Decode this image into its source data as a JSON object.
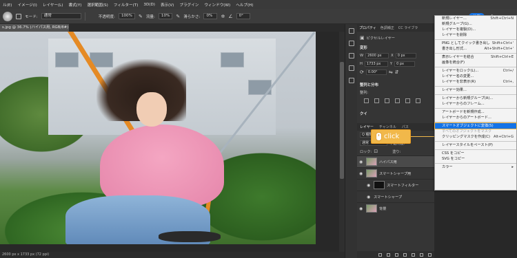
{
  "menubar": {
    "items": [
      "ル(E)",
      "イメージ(I)",
      "レイヤー(L)",
      "書式(Y)",
      "選択範囲(S)",
      "フィルター(T)",
      "3D(D)",
      "表示(V)",
      "プラグイン",
      "ウィンドウ(W)",
      "ヘルプ(H)"
    ]
  },
  "options": {
    "brush_size": "150",
    "mode_label": "モード:",
    "mode_value": "通常",
    "opacity_label": "不透明度:",
    "opacity_value": "100%",
    "flow_label": "流量:",
    "flow_value": "10%",
    "smoothing_label": "滑らかさ:",
    "smoothing_value": "0%",
    "angle_value": "0°",
    "share_label": "共有"
  },
  "document": {
    "tab_title": "s.jpg @ 36.7% (ハイパス用, RGB/8#) *",
    "status": "2600 px x 1733 px (72 ppi)"
  },
  "panel": {
    "tabs": [
      "プロパティ",
      "色調補正",
      "CC ライブラ"
    ],
    "layer_kind": "ピクセルレイヤー",
    "transform_heading": "変形",
    "w_label": "W",
    "w_value": "2600 px",
    "h_label": "H",
    "h_value": "1733 px",
    "x_label": "X",
    "x_value": "0 px",
    "y_label": "Y",
    "y_value": "0 px",
    "rotation_value": "0.00°",
    "align_heading": "整列と分布",
    "align_label": "整列:",
    "quick_heading": "クイ",
    "layer_tabs": [
      "レイヤー",
      "チャンネル",
      "パス"
    ],
    "kind_filter": "Q 種類",
    "blend_mode": "通常",
    "opacity_label": "不透明度:",
    "lock_label": "ロック:",
    "fill_label": "塗り:",
    "layers": [
      "ハイパス用",
      "スマートシャープ用",
      "スマートフィルター",
      "スマートシャープ",
      "背景"
    ]
  },
  "callout": {
    "label": "click"
  },
  "context_menu": {
    "items": [
      {
        "label": "新規レイヤー...",
        "shortcut": "Shift+Ctrl+N"
      },
      {
        "label": "新規グループ(G)...",
        "shortcut": ""
      },
      {
        "label": "レイヤーを複製(D)...",
        "shortcut": ""
      },
      {
        "label": "レイヤーを削除",
        "shortcut": ""
      },
      {
        "sep": true
      },
      {
        "label": "PNG としてクイック書き出し",
        "shortcut": "Shift+Ctrl+'"
      },
      {
        "label": "書き出し形式...",
        "shortcut": "Alt+Shift+Ctrl+'"
      },
      {
        "sep": true
      },
      {
        "label": "表示レイヤーを結合",
        "shortcut": "Shift+Ctrl+E"
      },
      {
        "label": "画像を統合(F)",
        "shortcut": ""
      },
      {
        "sep": true
      },
      {
        "label": "レイヤーをロック(L)...",
        "shortcut": "Ctrl+/"
      },
      {
        "label": "レイヤー名の変更...",
        "shortcut": ""
      },
      {
        "label": "レイヤーを非表示(R)",
        "shortcut": "Ctrl+,"
      },
      {
        "sep": true
      },
      {
        "label": "レイヤー効果...",
        "shortcut": ""
      },
      {
        "sep": true
      },
      {
        "label": "レイヤーから新規グループ(A)...",
        "shortcut": ""
      },
      {
        "label": "レイヤーからのフレーム...",
        "shortcut": ""
      },
      {
        "sep": true
      },
      {
        "label": "アートボードを新規作成...",
        "shortcut": ""
      },
      {
        "label": "レイヤーからのアートボード...",
        "shortcut": ""
      },
      {
        "sep": true
      },
      {
        "label": "スマートオブジェクトに変換(S)",
        "shortcut": "",
        "highlight": true
      },
      {
        "label": "すべてのオブジェクトをマスク",
        "shortcut": "",
        "dim": true
      },
      {
        "label": "クリッピングマスクを作成(C)",
        "shortcut": "Alt+Ctrl+G"
      },
      {
        "sep": true
      },
      {
        "label": "レイヤースタイルをペースト(P)",
        "shortcut": ""
      },
      {
        "sep": true
      },
      {
        "label": "CSS をコピー",
        "shortcut": ""
      },
      {
        "label": "SVG をコピー",
        "shortcut": ""
      },
      {
        "sep": true
      },
      {
        "label": "カラー",
        "shortcut": "▸"
      }
    ]
  }
}
